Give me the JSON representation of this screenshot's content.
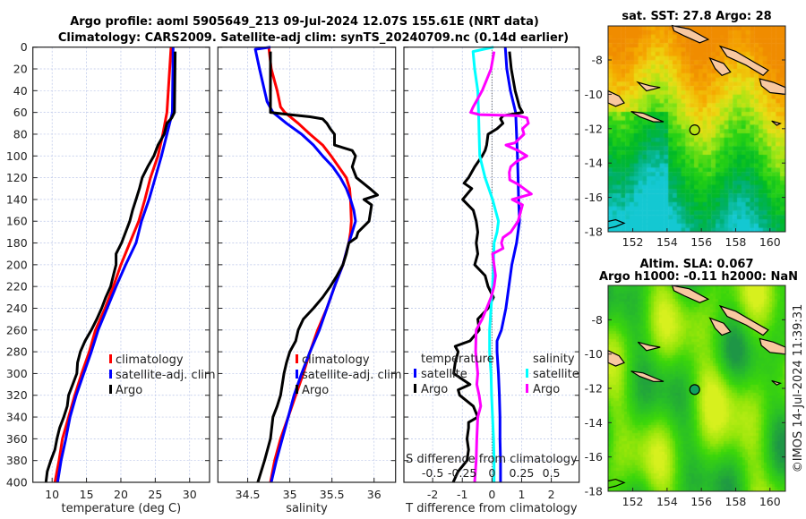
{
  "title": {
    "line1": "Argo profile: aoml 5905649_213 09-Jul-2024 12.07S 155.61E (NRT data)",
    "line2": "Climatology: CARS2009. Satellite-adj clim: synTS_20240709.nc (0.14d earlier)"
  },
  "timestamp": "©IMOS 14-Jul-2024 11:39:31",
  "colors": {
    "climatology": "#ff0000",
    "satellite": "#0000ff",
    "argo": "#000000",
    "sal_satellite": "#00ffff",
    "sal_argo": "#ff00ff",
    "land": "#f8c8a0"
  },
  "chart_data": [
    {
      "type": "line",
      "xlabel": "temperature (deg C)",
      "ylabel": "",
      "xlim": [
        7.2,
        32.9
      ],
      "ylim": [
        400,
        0
      ],
      "xticks": [
        10,
        15,
        20,
        25,
        30
      ],
      "yticks": [
        0,
        20,
        40,
        60,
        80,
        100,
        120,
        140,
        160,
        180,
        200,
        220,
        240,
        260,
        280,
        300,
        320,
        340,
        360,
        380,
        400
      ],
      "grid": true,
      "legend": {
        "placement": "lower-center",
        "entries": [
          "climatology",
          "satellite-adj. clim",
          "Argo"
        ]
      },
      "series": [
        {
          "name": "climatology",
          "color": "#ff0000",
          "depth": [
            0,
            60,
            80,
            100,
            120,
            140,
            160,
            180,
            200,
            220,
            240,
            260,
            280,
            300,
            320,
            340,
            360,
            380,
            400
          ],
          "values": [
            27.3,
            26.7,
            26.1,
            25.4,
            24.3,
            23.5,
            22.6,
            21.3,
            20.0,
            18.9,
            17.7,
            16.3,
            15.4,
            14.3,
            13.3,
            12.4,
            11.5,
            11.0,
            10.4
          ]
        },
        {
          "name": "satellite-adj. clim",
          "color": "#0000ff",
          "depth": [
            0,
            60,
            80,
            100,
            120,
            140,
            160,
            180,
            200,
            220,
            240,
            260,
            280,
            300,
            320,
            340,
            360,
            380,
            400
          ],
          "values": [
            27.6,
            27.5,
            26.7,
            25.9,
            25.0,
            24.1,
            23.0,
            22.2,
            20.7,
            19.3,
            18.0,
            16.7,
            15.7,
            14.6,
            13.5,
            12.6,
            12.0,
            11.3,
            10.8
          ]
        },
        {
          "name": "Argo",
          "color": "#000000",
          "depth": [
            4,
            60,
            65,
            70,
            80,
            90,
            100,
            110,
            120,
            130,
            140,
            150,
            160,
            170,
            180,
            190,
            200,
            210,
            220,
            230,
            240,
            250,
            260,
            270,
            280,
            290,
            300,
            310,
            320,
            330,
            340,
            350,
            360,
            370,
            380,
            390,
            400
          ],
          "values": [
            27.9,
            27.8,
            27.4,
            26.7,
            26.3,
            25.4,
            24.8,
            23.9,
            23.1,
            22.7,
            22.2,
            21.7,
            21.3,
            20.7,
            20.1,
            19.3,
            19.3,
            18.9,
            18.5,
            17.8,
            17.2,
            16.5,
            15.7,
            14.8,
            14.1,
            13.7,
            13.6,
            13.0,
            12.4,
            12.2,
            11.7,
            11.1,
            10.7,
            10.4,
            9.8,
            9.3,
            9.1
          ]
        }
      ]
    },
    {
      "type": "line",
      "xlabel": "salinity",
      "xlim": [
        34.146,
        36.255
      ],
      "ylim": [
        400,
        0
      ],
      "xticks": [
        34.5,
        35,
        35.5,
        36
      ],
      "grid": true,
      "legend": {
        "placement": "lower-center",
        "entries": [
          "climatology",
          "satellite-adj. clim",
          "Argo"
        ]
      },
      "series": [
        {
          "name": "climatology",
          "color": "#ff0000",
          "depth": [
            0,
            20,
            40,
            55,
            60,
            70,
            80,
            90,
            100,
            110,
            120,
            130,
            140,
            160,
            170,
            180,
            200,
            220,
            240,
            260,
            280,
            300,
            320,
            340,
            360,
            380,
            400
          ],
          "values": [
            34.75,
            34.78,
            34.85,
            34.89,
            34.94,
            35.1,
            35.24,
            35.39,
            35.49,
            35.58,
            35.67,
            35.71,
            35.72,
            35.73,
            35.72,
            35.7,
            35.63,
            35.53,
            35.44,
            35.33,
            35.24,
            35.16,
            35.07,
            34.98,
            34.89,
            34.82,
            34.77
          ]
        },
        {
          "name": "satellite-adj. clim",
          "color": "#0000ff",
          "depth": [
            0,
            2,
            20,
            40,
            50,
            60,
            70,
            80,
            90,
            100,
            110,
            120,
            130,
            140,
            150,
            160,
            170,
            180,
            200,
            220,
            240,
            260,
            280,
            300,
            320,
            340,
            360,
            380,
            400
          ],
          "values": [
            34.77,
            34.59,
            34.64,
            34.7,
            34.73,
            34.8,
            34.96,
            35.14,
            35.28,
            35.39,
            35.51,
            35.6,
            35.67,
            35.72,
            35.76,
            35.78,
            35.74,
            35.7,
            35.63,
            35.53,
            35.44,
            35.35,
            35.24,
            35.14,
            35.05,
            34.98,
            34.91,
            34.84,
            34.78
          ]
        },
        {
          "name": "Argo",
          "color": "#000000",
          "depth": [
            4,
            60,
            62,
            64,
            66,
            70,
            75,
            80,
            90,
            95,
            100,
            110,
            120,
            130,
            136,
            140,
            145,
            160,
            170,
            175,
            180,
            190,
            200,
            210,
            220,
            230,
            240,
            250,
            260,
            270,
            280,
            290,
            300,
            310,
            320,
            330,
            340,
            360,
            380,
            400
          ],
          "values": [
            34.77,
            34.77,
            35.0,
            35.24,
            35.39,
            35.44,
            35.48,
            35.53,
            35.53,
            35.74,
            35.78,
            35.74,
            35.79,
            35.95,
            36.04,
            35.88,
            35.97,
            35.94,
            35.81,
            35.79,
            35.7,
            35.67,
            35.63,
            35.56,
            35.48,
            35.39,
            35.28,
            35.16,
            35.1,
            35.07,
            35.0,
            34.96,
            34.93,
            34.91,
            34.89,
            34.85,
            34.8,
            34.77,
            34.7,
            34.62
          ]
        }
      ]
    },
    {
      "type": "line",
      "xlabel": "T difference from climatology",
      "x2label": "S difference from climatology",
      "xlim": [
        -2.97,
        2.94
      ],
      "x2lim": [
        -0.7425,
        0.735
      ],
      "ylim": [
        400,
        0
      ],
      "xticks": [
        -2,
        -1,
        0,
        1,
        2
      ],
      "x2ticks": [
        -0.5,
        -0.25,
        0,
        0.25,
        0.5
      ],
      "x2ticklabels": [
        "-0.5",
        "-0.25",
        "0",
        "0.25",
        "0.5"
      ],
      "grid": true,
      "legend": {
        "placement": "lower",
        "temperature_title": "temperature",
        "salinity_title": "salinity",
        "temperature_entries": [
          "satellite",
          "Argo"
        ],
        "salinity_entries": [
          "satellite",
          "Argo"
        ]
      },
      "series": [
        {
          "name": "satellite",
          "group": "temperature",
          "axis": "T",
          "color": "#0000ff",
          "depth": [
            0,
            20,
            40,
            60,
            80,
            100,
            120,
            140,
            160,
            180,
            200,
            220,
            240,
            260,
            270,
            280,
            300,
            320,
            340,
            360,
            380,
            400
          ],
          "values": [
            0.45,
            0.5,
            0.62,
            0.8,
            0.83,
            0.86,
            0.88,
            0.9,
            0.93,
            0.83,
            0.67,
            0.57,
            0.47,
            0.32,
            0.17,
            0.17,
            0.22,
            0.25,
            0.27,
            0.27,
            0.29,
            0.29
          ]
        },
        {
          "name": "Argo",
          "group": "temperature",
          "axis": "T",
          "color": "#000000",
          "depth": [
            4,
            20,
            40,
            55,
            60,
            63,
            66,
            70,
            75,
            80,
            90,
            95,
            100,
            110,
            120,
            125,
            130,
            140,
            150,
            160,
            170,
            180,
            190,
            200,
            210,
            220,
            230,
            240,
            250,
            260,
            270,
            275,
            280,
            290,
            300,
            310,
            315,
            320,
            330,
            340,
            345,
            350,
            360,
            370,
            380,
            390,
            400
          ],
          "values": [
            0.59,
            0.65,
            0.78,
            0.93,
            1.03,
            0.37,
            0.29,
            0.37,
            0.17,
            -0.13,
            -0.18,
            -0.23,
            -0.33,
            -0.58,
            -0.79,
            -0.94,
            -0.68,
            -0.99,
            -0.63,
            -0.53,
            -0.48,
            -0.53,
            -0.48,
            -0.58,
            -0.23,
            -0.13,
            0.05,
            -0.13,
            -0.48,
            -0.43,
            -0.74,
            -1.24,
            -1.14,
            -1.24,
            -1.29,
            -0.74,
            -1.14,
            -1.09,
            -0.63,
            -0.48,
            -0.79,
            -0.79,
            -0.84,
            -0.79,
            -0.84,
            -1.14,
            -1.31
          ]
        },
        {
          "name": "satellite",
          "group": "salinity",
          "axis": "S",
          "color": "#00ffff",
          "depth": [
            0,
            4,
            20,
            40,
            60,
            80,
            100,
            120,
            140,
            150,
            160,
            170,
            180,
            200,
            220,
            240,
            260,
            280,
            300,
            320,
            340,
            360,
            380,
            400
          ],
          "values": [
            0.013,
            -0.16,
            -0.146,
            -0.12,
            -0.113,
            -0.108,
            -0.103,
            -0.058,
            0.005,
            0.03,
            0.055,
            0.043,
            0.018,
            0.013,
            0.005,
            -0.008,
            -0.02,
            -0.02,
            -0.008,
            -0.003,
            0.005,
            0.013,
            0.018,
            0.018
          ]
        },
        {
          "name": "Argo",
          "group": "salinity",
          "axis": "S",
          "color": "#ff00ff",
          "depth": [
            4,
            20,
            30,
            40,
            55,
            60,
            62,
            63,
            65,
            70,
            75,
            80,
            88,
            90,
            95,
            100,
            105,
            110,
            115,
            122,
            126,
            135,
            140,
            145,
            160,
            170,
            175,
            180,
            185,
            190,
            200,
            210,
            220,
            230,
            240,
            250,
            260,
            280,
            300,
            310,
            320,
            330,
            340,
            360,
            380,
            400
          ],
          "values": [
            0.018,
            -0.008,
            -0.045,
            -0.083,
            -0.159,
            -0.179,
            -0.108,
            0.22,
            0.295,
            0.307,
            0.257,
            0.27,
            0.194,
            0.118,
            0.219,
            0.295,
            0.209,
            0.158,
            0.146,
            0.15,
            0.22,
            0.332,
            0.17,
            0.257,
            0.22,
            0.158,
            0.093,
            0.08,
            0.093,
            0.005,
            0.018,
            0.03,
            0.018,
            -0.008,
            -0.045,
            -0.083,
            -0.133,
            -0.138,
            -0.12,
            -0.128,
            -0.108,
            -0.095,
            -0.12,
            -0.128,
            -0.133,
            -0.146
          ]
        }
      ]
    },
    {
      "type": "heatmap",
      "title": "sat. SST: 27.8 Argo: 28",
      "xlim": [
        150.56,
        160.9
      ],
      "ylim": [
        -18.0,
        -6.02
      ],
      "xticks": [
        152,
        154,
        156,
        158,
        160
      ],
      "yticks": [
        -8,
        -10,
        -12,
        -14,
        -16,
        -18
      ],
      "yticklabels": [
        "-8",
        "-10",
        "-12",
        "-14",
        "-16",
        "-18"
      ],
      "marker": {
        "lon": 155.61,
        "lat": -12.07,
        "filled": false
      }
    },
    {
      "type": "heatmap",
      "title": "Altim. SLA: 0.067",
      "subtitle": "Argo h1000: -0.11 h2000: NaN",
      "xlim": [
        150.56,
        160.9
      ],
      "ylim": [
        -18.0,
        -6.0
      ],
      "xticks": [
        152,
        154,
        156,
        158,
        160
      ],
      "yticks": [
        -8,
        -10,
        -12,
        -14,
        -16,
        -18
      ],
      "yticklabels": [
        "-8",
        "-10",
        "-12",
        "-14",
        "-16",
        "-18"
      ],
      "marker": {
        "lon": 155.61,
        "lat": -12.07,
        "filled": true,
        "color": "#10a060"
      }
    }
  ]
}
